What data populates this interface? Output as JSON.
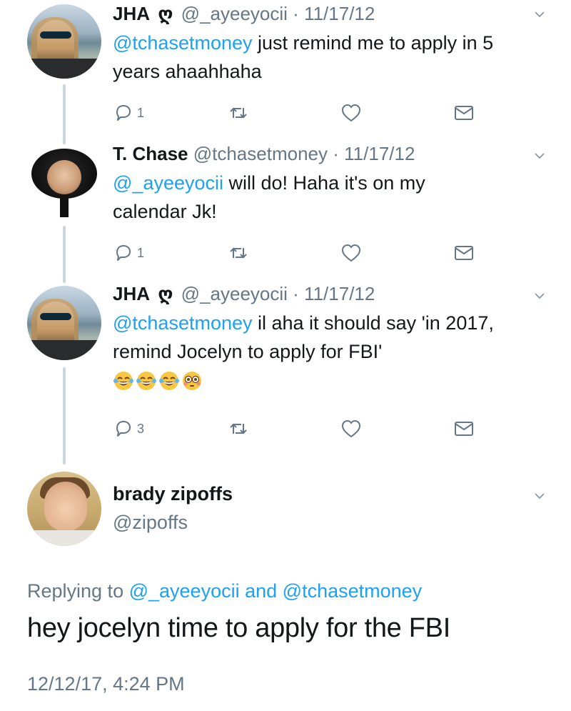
{
  "tweets": [
    {
      "name": "JHA",
      "symbol": "ღ",
      "handle": "@_ayeeyocii",
      "dot": "·",
      "date": "11/17/12",
      "mention": "@tchasetmoney",
      "text": " just remind me to apply in 5 years ahaahhaha",
      "reply_count": "1"
    },
    {
      "name": "T. Chase",
      "handle": "@tchasetmoney",
      "dot": "·",
      "date": "11/17/12",
      "mention": "@_ayeeyocii",
      "text": " will do! Haha it's on my calendar Jk!",
      "reply_count": "1"
    },
    {
      "name": "JHA",
      "symbol": "ღ",
      "handle": "@_ayeeyocii",
      "dot": "·",
      "date": "11/17/12",
      "mention": "@tchasetmoney",
      "text": " il aha it should say 'in 2017, remind Jocelyn to apply for FBI'",
      "emojis": [
        "tears-of-joy-emoji",
        "tears-of-joy-emoji",
        "tears-of-joy-emoji",
        "flushed-face-emoji"
      ],
      "reply_count": "3"
    }
  ],
  "main_tweet": {
    "name": "brady zipoffs",
    "handle": "@zipoffs",
    "replying_prefix": "Replying to ",
    "replying_mention_1": "@_ayeeyocii",
    "replying_and": " and ",
    "replying_mention_2": "@tchasetmoney",
    "text": "hey jocelyn time to apply for the FBI",
    "timestamp": "12/12/17, 4:24 PM"
  },
  "colors": {
    "link": "#1da1f2",
    "secondary": "#657786",
    "thread_line": "#ccd6dd"
  },
  "icons": [
    "reply-icon",
    "retweet-icon",
    "like-icon",
    "message-icon",
    "chevron-down-icon"
  ]
}
